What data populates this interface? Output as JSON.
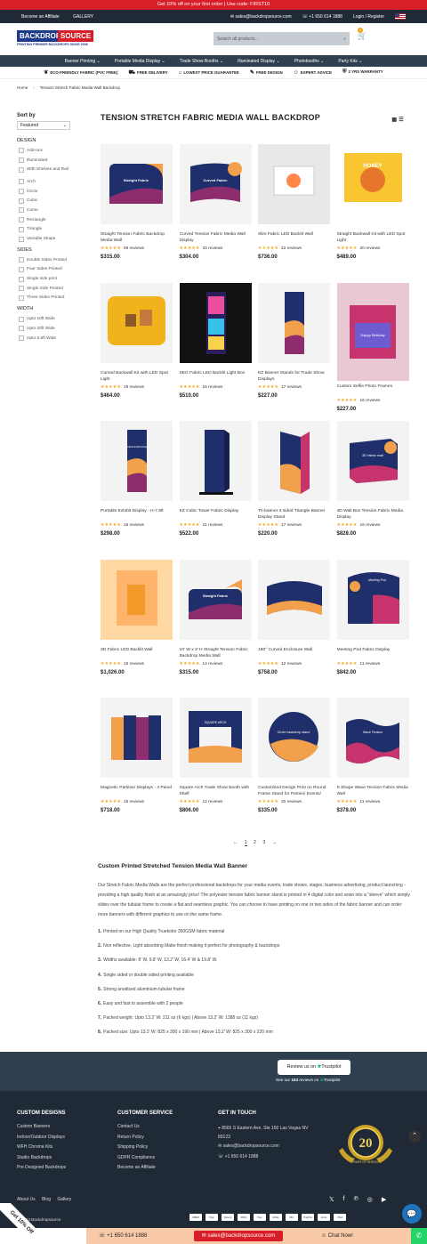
{
  "promo": "Get 10% off on your first order | Use code: FIRST10",
  "topbar": {
    "affiliate": "Become an Affiliate",
    "gallery": "GALLERY",
    "email": "sales@backdropsource.com",
    "phone": "+1 650 614 1888",
    "login": "Login / Register"
  },
  "logo": {
    "part1": "BACKDROP",
    "part2": "SOURCE",
    "tagline": "PRINTING PREMIER BACKDROPS SINCE 2008"
  },
  "search": {
    "placeholder": "Search all products..."
  },
  "cart_count": "0",
  "nav": [
    "Banner Printing",
    "Portable Media Display",
    "Trade Show Booths",
    "Illuminated Display",
    "Photobooths",
    "Party Kits"
  ],
  "usp": [
    "ECO-FRIENDLY FABRIC (PVC FREE)",
    "FREE DELIVERY",
    "LOWEST PRICE GUARANTEE",
    "FREE DESIGN",
    "EXPERT ADVICE",
    "2 YRS WARRANTY"
  ],
  "breadcrumb": {
    "home": "Home",
    "current": "Tension Stretch Fabric Media Wall Backdrop"
  },
  "sort": {
    "label": "Sort by",
    "value": "Featured"
  },
  "filters": {
    "design_title": "DESIGN",
    "design": [
      "Add-ons",
      "Illuminated",
      "With Shelves and Rail",
      "Arch",
      "Circle",
      "Cubic",
      "Curve",
      "Rectangle",
      "Triangle",
      "Variable Shape"
    ],
    "sides_title": "SIDES",
    "sides": [
      "Double Sides Printed",
      "Four Sides Printed",
      "Single side print",
      "Single Side Printed",
      "Three Sides Printed"
    ],
    "width_title": "WIDTH",
    "width": [
      "Upto 10ft Wide",
      "Upto 20ft Wide",
      "Upto 6.5ft Wide"
    ]
  },
  "page_title": "TENSION STRETCH FABRIC MEDIA WALL BACKDROP",
  "products": [
    {
      "name": "Straight Tension Fabric Backdrop Media Wall",
      "reviews": "59 reviews",
      "price": "$315.00",
      "kind": "straight",
      "art": "Straight Fabric"
    },
    {
      "name": "Curved Tension Fabric Media Wall Display",
      "reviews": "33 reviews",
      "price": "$304.00",
      "kind": "curved",
      "art": "Curved Fabric"
    },
    {
      "name": "Slim Fabric LED Backlit Wall",
      "reviews": "22 reviews",
      "price": "$736.00",
      "kind": "slim",
      "art": ""
    },
    {
      "name": "Straight Backwall Kit with LED Spot Light",
      "reviews": "20 reviews",
      "price": "$489.00",
      "kind": "honey",
      "art": "HONEY"
    },
    {
      "name": "Curved Backwall Kit with LED Spot Light",
      "reviews": "19 reviews",
      "price": "$464.00",
      "kind": "yellow",
      "art": ""
    },
    {
      "name": "SEG Fabric LED Backlit Light Box",
      "reviews": "16 reviews",
      "price": "$510.00",
      "kind": "seg",
      "art": ""
    },
    {
      "name": "EZ Banner Stands for Trade Show Displays",
      "reviews": "17 reviews",
      "price": "$227.00",
      "kind": "ez",
      "art": ""
    },
    {
      "name": "Custom Selfie Photo Frames",
      "reviews": "16 reviews",
      "price": "$227.00",
      "kind": "selfie",
      "art": "Happy Birthday"
    },
    {
      "name": "Portable Exhibit Display - H-7.5ft",
      "reviews": "16 reviews",
      "price": "$298.00",
      "kind": "tower",
      "art": "Portable Exhibit Display"
    },
    {
      "name": "EZ Cubic Tower Fabric Display",
      "reviews": "21 reviews",
      "price": "$522.00",
      "kind": "cubic",
      "art": "Cubic Tower"
    },
    {
      "name": "Tri-banner 3 sided Triangle Banner Display Stand",
      "reviews": "17 reviews",
      "price": "$220.00",
      "kind": "tri",
      "art": ""
    },
    {
      "name": "3D Wall Box Tension Fabric Media Display",
      "reviews": "16 reviews",
      "price": "$828.00",
      "kind": "box",
      "art": "3D fabric wall"
    },
    {
      "name": "3D Fabric LED Backlit Wall",
      "reviews": "15 reviews",
      "price": "$1,026.00",
      "kind": "led3d",
      "art": ""
    },
    {
      "name": "10' W x 3' H Straight Tension Fabric Backdrop Media Wall",
      "reviews": "14 reviews",
      "price": "$315.00",
      "kind": "short",
      "art": "Straight Fabric"
    },
    {
      "name": "180° Curved Enclosure Wall",
      "reviews": "12 reviews",
      "price": "$758.00",
      "kind": "enclosure",
      "art": ""
    },
    {
      "name": "Meeting Pod Fabric Display",
      "reviews": "11 reviews",
      "price": "$842.00",
      "kind": "pod",
      "art": "Meeting Pod"
    },
    {
      "name": "Magnetic Partition Displays - 4 Panel",
      "reviews": "15 reviews",
      "price": "$718.00",
      "kind": "partition",
      "art": ""
    },
    {
      "name": "Square Arch Trade Show Booth with Shelf",
      "reviews": "12 reviews",
      "price": "$806.00",
      "kind": "arch",
      "art": "SQUARE ARCH"
    },
    {
      "name": "Customized Design Print on Round Frame Stand for Parties/ Events/ Weddings",
      "reviews": "20 reviews",
      "price": "$335.00",
      "kind": "circle",
      "art": "Circle backdrop stand"
    },
    {
      "name": "S Shape Wave Tension Fabric Media Wall",
      "reviews": "11 reviews",
      "price": "$378.00",
      "kind": "wave",
      "art": "Wave Tension"
    }
  ],
  "pagination": [
    "←",
    "1",
    "2",
    "3",
    "→"
  ],
  "description": {
    "title": "Custom Printed Stretched Tension Media Wall Banner",
    "para": "Our Stretch Fabric Media Walls are the perfect professional backdrops for your media events, trade shows, stages, business advertising, product launching - providing a high quality finish at an amazingly price! The polyester tension fabric banner stand is printed in 4 digital color and sewn into a \"sleeve\" which simply slides over the tubular frame to create a flat and seamless graphic. You can choose to have printing on one or two sides of the fabric banner and can order more banners with different graphics to use on the same frame.",
    "points": [
      {
        "n": "1.",
        "t": "Printed on our High Quality Truekolor 350GSM fabric material"
      },
      {
        "n": "2.",
        "t": "Non reflective, Light absorbing Matte finish making it perfect for photography & backdrops"
      },
      {
        "n": "3.",
        "t": "Widths available: 8' W, 9.8' W, 13.2' W, 16.4' W & 19.8' W."
      },
      {
        "n": "4.",
        "t": "Single sided or double sided printing available"
      },
      {
        "n": "5.",
        "t": "Strong anodized aluminium tubular frame"
      },
      {
        "n": "6.",
        "t": "Easy and fast to assemble with 2 people"
      },
      {
        "n": "7.",
        "t": "Packed weight: Upto 13.2' W: 211 oz (6 kgs) | Above 13.2' W: 1388 oz (11 kgs)"
      },
      {
        "n": "8.",
        "t": "Packed size: Upto 13.2' W: 825 x 300 x 190 mm | Above 13.2' W: 825 x 300 x 220 mm"
      }
    ]
  },
  "trustpilot": {
    "review_on": "Review us on",
    "brand": "Trustpilot",
    "see": "See our",
    "count": "153",
    "reviews_on": "reviews on"
  },
  "footer": {
    "designs_title": "CUSTOM DESIGNS",
    "designs": [
      "Custom Banners",
      "Indoor/Outdoor Displays",
      "WFH Chroma Kits",
      "Studio Backdrops",
      "Pre Designed Backdrops"
    ],
    "service_title": "CUSTOMER SERVICE",
    "service": [
      "Contact Us",
      "Return Policy",
      "Shipping Policy",
      "GDPR Compliance",
      "Become an Affiliate"
    ],
    "touch_title": "GET IN TOUCH",
    "address": "8565 S Eastern Ave, Ste 150 Las Vegas NV 89123",
    "email": "sales@backdropsource.com",
    "phone": "+1 650 614 1888",
    "medal_number": "20",
    "medal_text": "YEARS OF SERVICE",
    "links": [
      "About Us",
      "Blog",
      "Gallery"
    ],
    "copyright": "© 2024 Backdropsource",
    "payments": [
      "AMEX",
      "Pay",
      "Diners",
      "DISC",
      "Pay",
      "GPay",
      "MC",
      "PayPal",
      "shop",
      "VISA"
    ]
  },
  "cta": {
    "phone": "+1 650 614 1888",
    "email": "sales@backdropsource.com",
    "chat": "Chat Now!"
  },
  "off_tab": "Get 10% Off"
}
